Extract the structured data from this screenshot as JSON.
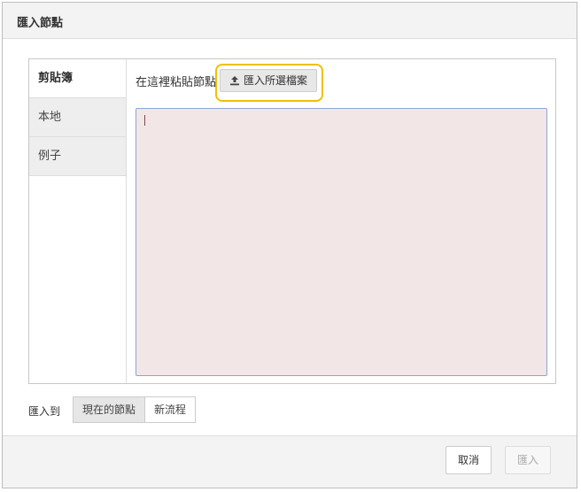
{
  "dialog": {
    "title": "匯入節點"
  },
  "tabs": [
    {
      "label": "剪貼簿",
      "active": true
    },
    {
      "label": "本地",
      "active": false
    },
    {
      "label": "例子",
      "active": false
    }
  ],
  "clipboard": {
    "paste_label": "在這裡粘貼節點",
    "import_file_label": "匯入所選檔案",
    "import_file_icon": "upload-icon",
    "textarea_value": "",
    "textarea_bg": "#f3e6e6"
  },
  "import_to": {
    "label": "匯入到",
    "options": [
      {
        "label": "現在的節點",
        "selected": true
      },
      {
        "label": "新流程",
        "selected": false
      }
    ]
  },
  "footer": {
    "cancel_label": "取消",
    "import_label": "匯入",
    "import_disabled": true
  },
  "highlight_color": "#f0c000"
}
